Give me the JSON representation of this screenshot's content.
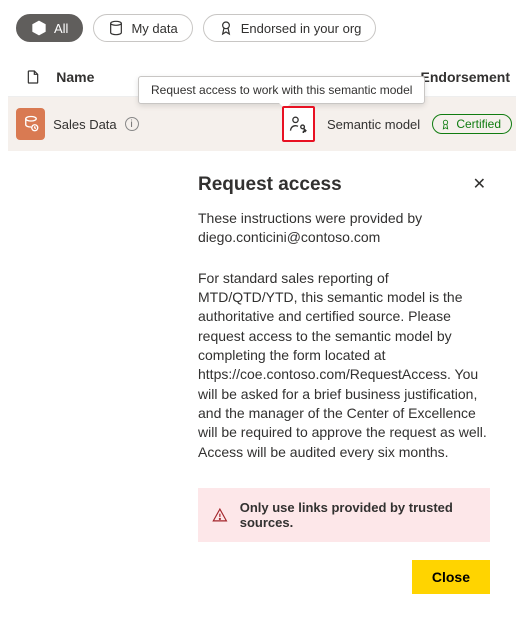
{
  "filters": {
    "all": "All",
    "mine": "My data",
    "endorsed": "Endorsed in your org"
  },
  "table": {
    "head": {
      "name": "Name",
      "type": "",
      "endorsement": "Endorsement"
    },
    "row": {
      "name": "Sales Data",
      "type": "Semantic model",
      "badge": "Certified"
    }
  },
  "tooltip": "Request access to work with this semantic model",
  "panel": {
    "title": "Request access",
    "sub_line1": "These instructions were provided by",
    "sub_line2": "diego.conticini@contoso.com",
    "body": "For standard sales reporting of MTD/QTD/YTD, this semantic model is the authoritative and certified source. Please request access to the semantic model by completing the form located at https://coe.contoso.com/RequestAccess. You will be asked for a brief business justification, and the manager of the Center of Excellence will be required to approve the request as well. Access will be audited every six months.",
    "warning": "Only use links provided by trusted sources.",
    "close": "Close"
  }
}
